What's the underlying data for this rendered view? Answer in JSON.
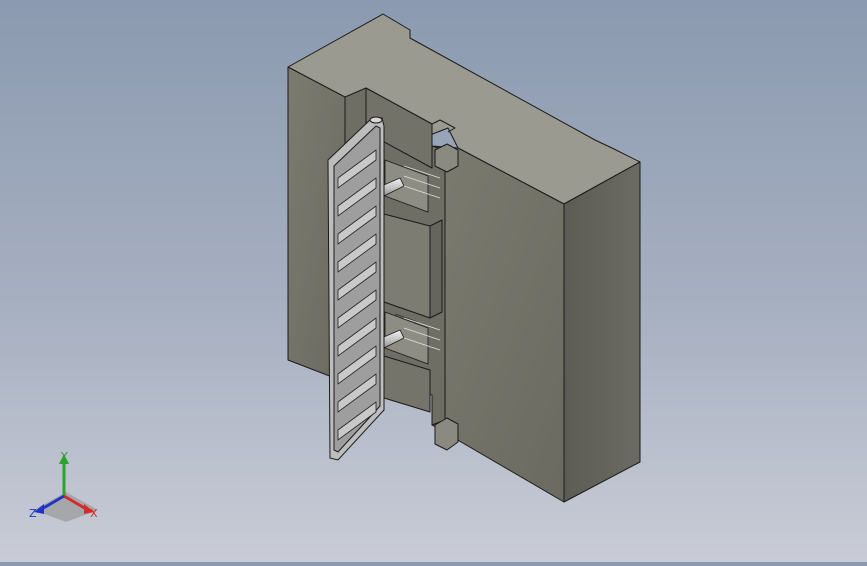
{
  "window": {
    "title": ""
  },
  "triad": {
    "labels": {
      "y": "Y",
      "x": "X",
      "z": "Z"
    },
    "colors": {
      "x": "#d42b2b",
      "y": "#2ea12e",
      "z": "#2035c8"
    }
  },
  "colors": {
    "background_top": "#8b9ab0",
    "background_bottom": "#c9ccd6",
    "block_front": "#75756a",
    "block_top": "#9a9a90",
    "block_side": "#606058",
    "outline": "#1a1a1a",
    "ladder": "#c8c8c8"
  }
}
